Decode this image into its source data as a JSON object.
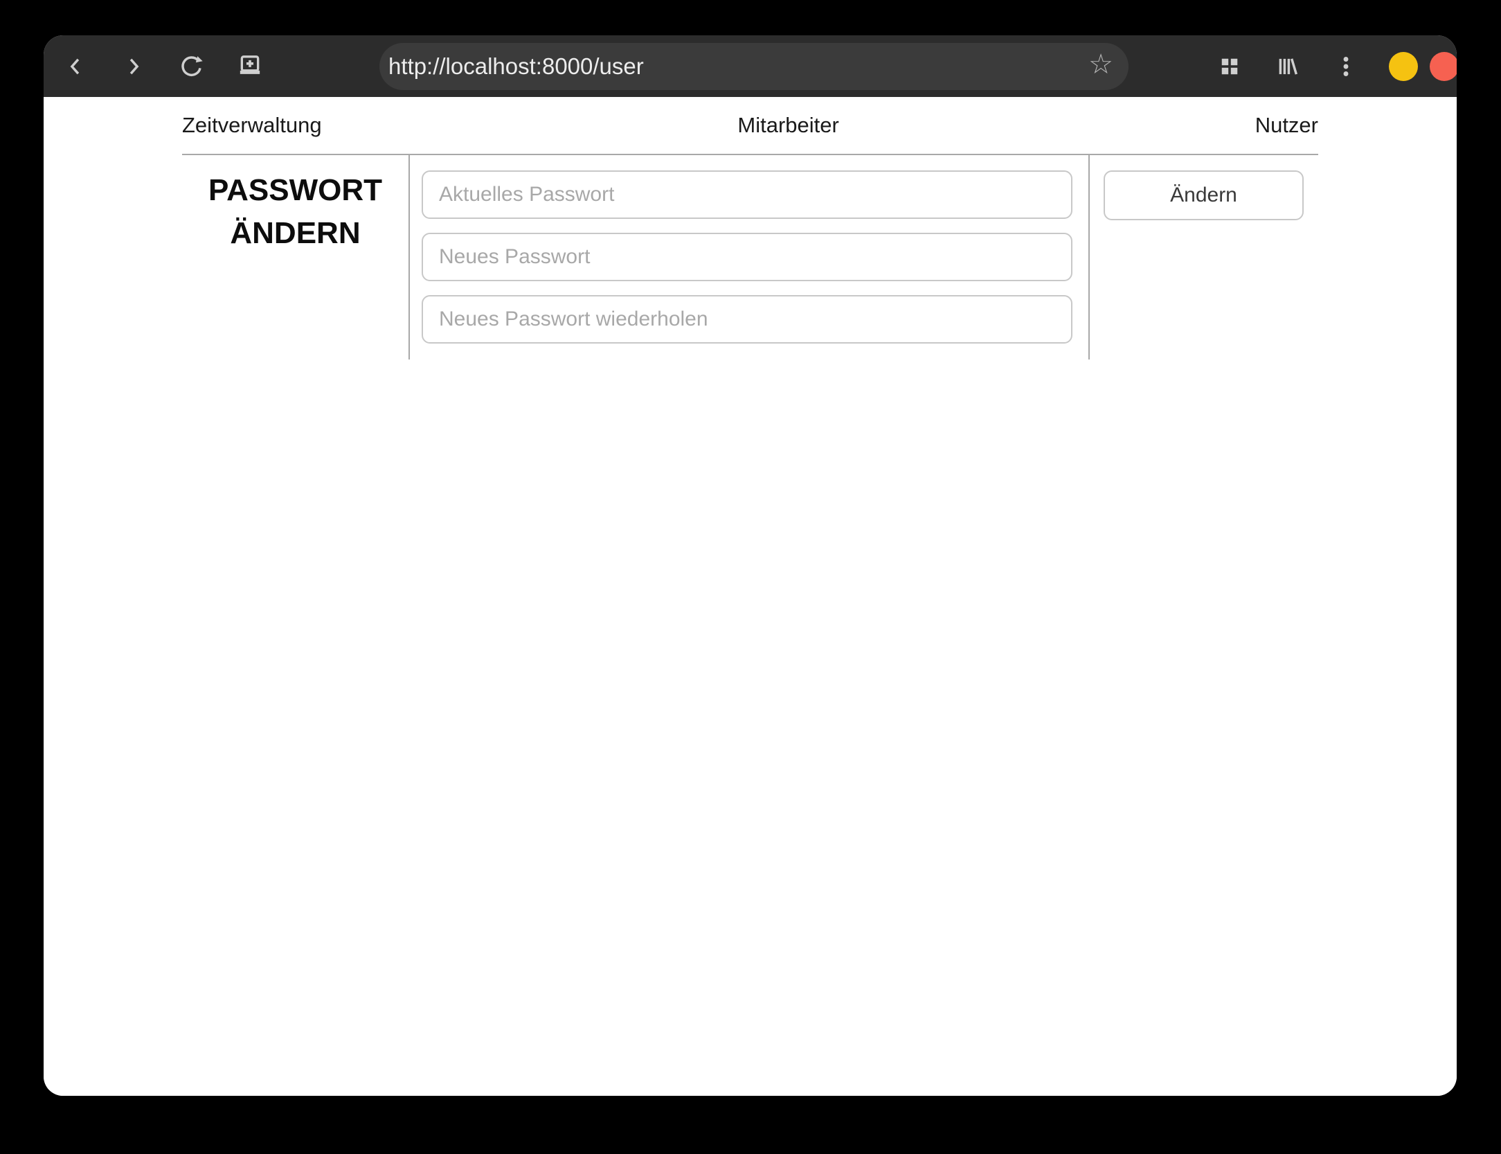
{
  "browser": {
    "url": "http://localhost:8000/user",
    "bookmark_star_glyph": "☆",
    "colors": {
      "toolbar_bg": "#2c2c2c",
      "urlbar_bg": "#3b3b3b",
      "icon": "#cfcfcf",
      "minimize_button": "#f5c211",
      "close_button": "#f66151"
    }
  },
  "nav": {
    "items": [
      {
        "id": "zeitverwaltung",
        "label": "Zeitverwaltung"
      },
      {
        "id": "mitarbeiter",
        "label": "Mitarbeiter"
      },
      {
        "id": "nutzer",
        "label": "Nutzer"
      }
    ]
  },
  "password_section": {
    "heading_line1": "PASSWORT",
    "heading_line2": "ÄNDERN",
    "fields": [
      {
        "placeholder": "Aktuelles Passwort",
        "value": ""
      },
      {
        "placeholder": "Neues Passwort",
        "value": ""
      },
      {
        "placeholder": "Neues Passwort wiederholen",
        "value": ""
      }
    ],
    "submit_label": "Ändern",
    "colors": {
      "divider": "#a8a8a8",
      "input_border": "#c8c8c8",
      "placeholder_text": "#a8a8a8"
    }
  }
}
